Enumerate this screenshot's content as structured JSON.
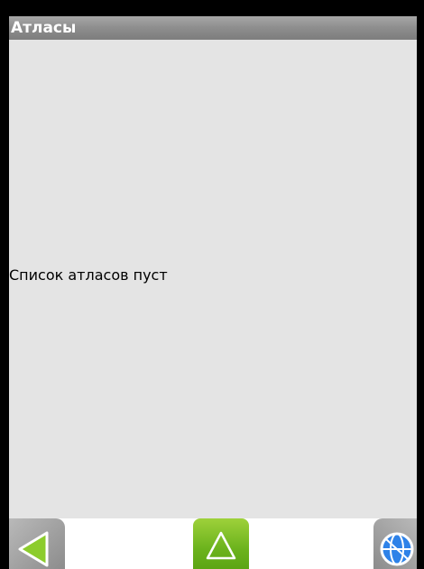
{
  "window": {
    "title": "Атласы"
  },
  "content": {
    "empty_message": "Список атласов пуст"
  },
  "toolbar": {
    "back_icon": "triangle-left-icon",
    "up_icon": "triangle-up-icon",
    "map_icon": "globe-icon"
  },
  "colors": {
    "title_bar": "#8f8f8f",
    "content_bg": "#e4e4e4",
    "accent_green": "#7bbd26",
    "icon_green": "#8ccc2c",
    "globe_blue": "#2e82e8"
  }
}
